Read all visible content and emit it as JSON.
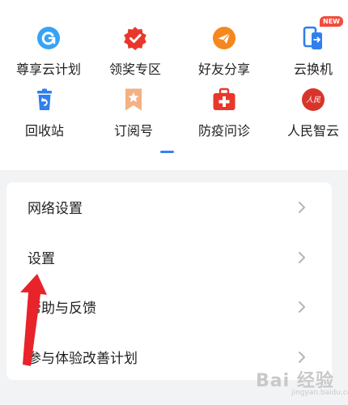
{
  "grid": {
    "items": [
      {
        "label": "尊享云计划",
        "icon": "cloud-refresh-icon",
        "color": "#36a3f7"
      },
      {
        "label": "领奖专区",
        "icon": "award-badge-icon",
        "color": "#e8382b"
      },
      {
        "label": "好友分享",
        "icon": "paper-plane-icon",
        "color": "#f5871f"
      },
      {
        "label": "云换机",
        "icon": "phone-transfer-icon",
        "color": "#2f7ff0",
        "badge": "NEW"
      },
      {
        "label": "回收站",
        "icon": "trash-icon",
        "color": "#2f7ff0"
      },
      {
        "label": "订阅号",
        "icon": "bookmark-star-icon",
        "color": "#f4b183"
      },
      {
        "label": "防疫问诊",
        "icon": "medical-kit-icon",
        "color": "#e8382b"
      },
      {
        "label": "人民智云",
        "icon": "people-cloud-logo-icon",
        "color": "#d8352a",
        "logo_text": "人民"
      }
    ],
    "page_indicator_color": "#3d7ef6"
  },
  "menu": {
    "items": [
      {
        "label": "网络设置"
      },
      {
        "label": "设置"
      },
      {
        "label": "帮助与反馈"
      },
      {
        "label": "参与体验改善计划"
      }
    ]
  },
  "overlay": {
    "arrow_color": "#e8232a"
  },
  "watermark": {
    "text": "Bai 经验",
    "sub": "jingyan.baidu.com"
  }
}
